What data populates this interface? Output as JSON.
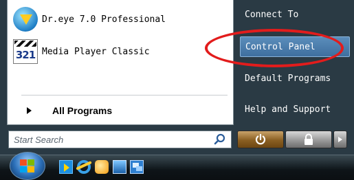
{
  "pinned_programs": [
    {
      "label": "Dr.eye 7.0 Professional",
      "icon": "dreye-icon"
    },
    {
      "label": "Media Player Classic",
      "icon": "media-player-classic-icon",
      "icon_text": "321"
    }
  ],
  "all_programs": {
    "label": "All Programs",
    "icon": "right-arrow-icon"
  },
  "search": {
    "placeholder": "Start Search",
    "value": "",
    "icon": "search-icon"
  },
  "right_pane": {
    "items": [
      {
        "label": "Connect To"
      },
      {
        "label": "Control Panel",
        "highlighted": true
      },
      {
        "label": "Default Programs"
      },
      {
        "label": "Help and Support"
      }
    ]
  },
  "power_buttons": {
    "power": {
      "icon": "power-icon"
    },
    "lock": {
      "icon": "lock-icon"
    },
    "more": {
      "icon": "arrow-right-icon"
    }
  },
  "taskbar": {
    "start_button": {
      "icon": "windows-orb-icon"
    },
    "quick_launch": [
      {
        "icon": "windows-media-player-icon"
      },
      {
        "icon": "internet-explorer-icon"
      },
      {
        "icon": "messenger-icon"
      },
      {
        "icon": "show-desktop-icon"
      },
      {
        "icon": "switch-windows-icon"
      }
    ]
  },
  "colors": {
    "highlight_ellipse": "#e21c1c",
    "right_pane_bg": "#2a3a44",
    "selected_item_bg": "#4f80b0"
  }
}
